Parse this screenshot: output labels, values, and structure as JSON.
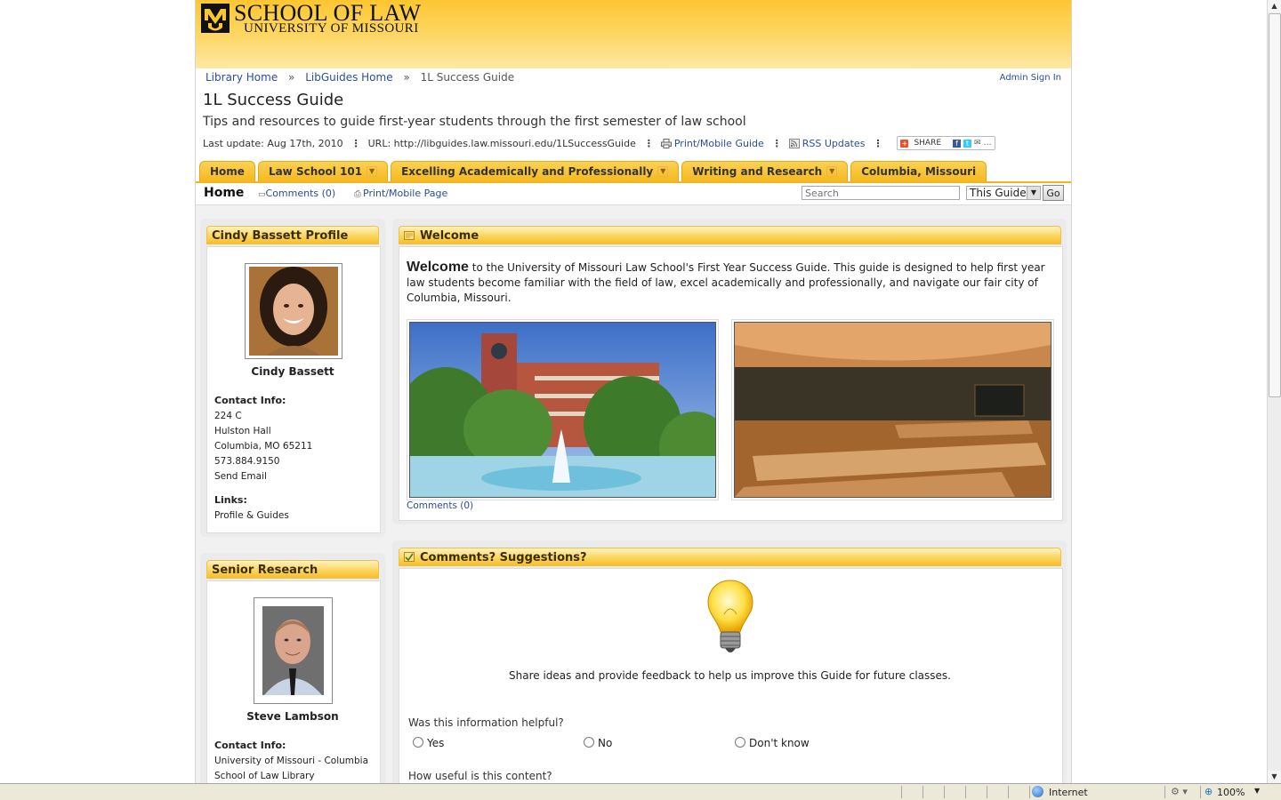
{
  "header": {
    "logo_title": "SCHOOL OF LAW",
    "logo_subtitle": "UNIVERSITY OF MISSOURI"
  },
  "breadcrumbs": [
    "Library Home",
    "LibGuides Home",
    "1L Success Guide"
  ],
  "breadcrumb_sep": "»",
  "admin_sign_in": "Admin Sign In",
  "guide": {
    "title": "1L Success Guide",
    "description": "Tips and resources to guide first-year students through the first semester of law school",
    "last_update": "Last update: Aug 17th, 2010",
    "url": "URL: http://libguides.law.missouri.edu/1LSuccessGuide",
    "print_label": "Print/Mobile Guide",
    "rss_label": "RSS Updates",
    "share_label": "SHARE"
  },
  "tabs": [
    {
      "label": "Home",
      "dropdown": false
    },
    {
      "label": "Law School 101",
      "dropdown": true
    },
    {
      "label": "Excelling Academically and Professionally",
      "dropdown": true
    },
    {
      "label": "Writing and Research",
      "dropdown": true
    },
    {
      "label": "Columbia, Missouri",
      "dropdown": false
    }
  ],
  "subbar": {
    "page_name": "Home",
    "comments": "Comments (0)",
    "print_page": "Print/Mobile Page",
    "search_placeholder": "Search",
    "scope": "This Guide",
    "go": "Go"
  },
  "profiles": [
    {
      "box_title": "Cindy Bassett Profile",
      "name": "Cindy Bassett",
      "contact_label": "Contact Info:",
      "contact_lines": [
        "224 C",
        "Hulston Hall",
        "Columbia, MO 65211",
        "573.884.9150"
      ],
      "email_link": "Send Email",
      "links_label": "Links:",
      "links": [
        "Profile & Guides"
      ]
    },
    {
      "box_title": "Senior Research Librarian",
      "name": "Steve Lambson",
      "contact_label": "Contact Info:",
      "contact_lines": [
        "University of Missouri - Columbia",
        "School of Law Library"
      ]
    }
  ],
  "welcome": {
    "box_title": "Welcome",
    "lead_word": "Welcome",
    "body": " to the University of Missouri Law School's First Year Success Guide. This guide is designed to help first year law students become familiar with the field of law, excel academically and professionally, and navigate our fair city of Columbia, Missouri.",
    "comments": "Comments (0)"
  },
  "feedback": {
    "box_title": "Comments? Suggestions?",
    "tagline": "Share ideas and provide feedback to help us improve this Guide for future classes.",
    "question1": "Was this information helpful?",
    "options": [
      "Yes",
      "No",
      "Don't know"
    ],
    "question2": "How useful is this content?"
  },
  "statusbar": {
    "zone": "Internet",
    "zoom": "100%"
  },
  "colors": {
    "banner_gold": "#fdc630",
    "link_blue": "#2b4d9c",
    "tab_gold": "#f6b920"
  }
}
